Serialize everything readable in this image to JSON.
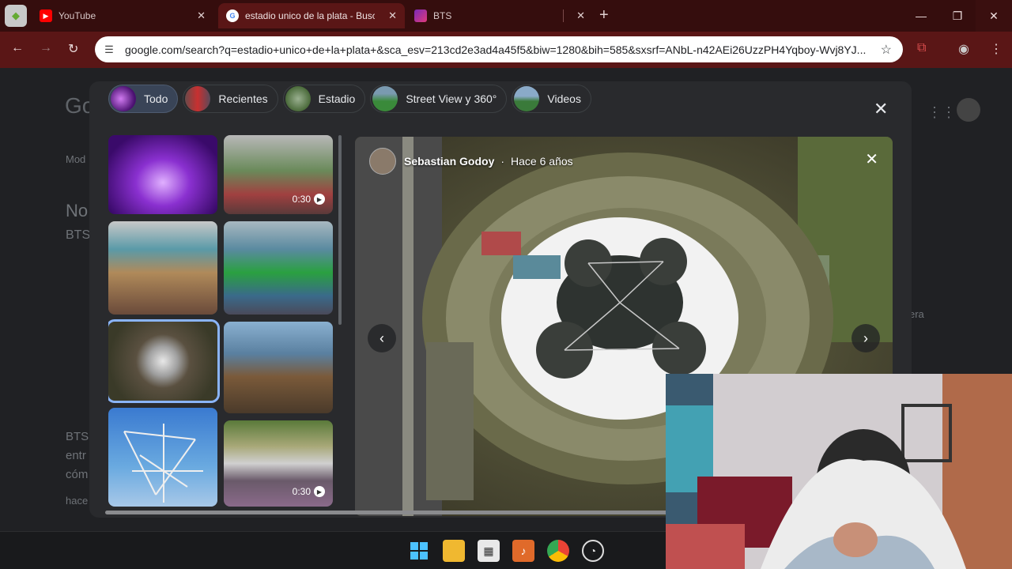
{
  "browser": {
    "tabs": [
      {
        "title": "YouTube",
        "active": false
      },
      {
        "title": "estadio unico de la plata - Busca",
        "active": true
      },
      {
        "title": "BTS",
        "active": false
      }
    ],
    "url": "google.com/search?q=estadio+unico+de+la+plata+&sca_esv=213cd2e3ad4a45f5&biw=1280&bih=585&sxsrf=ANbL-n42AEi26UzzPH4Yqboy-Wvj8YJ..."
  },
  "background_page": {
    "logo": "Go",
    "mode_label": "Mod",
    "no_text": "No",
    "bts_text": "BTS",
    "snippet_lines": [
      "BTS",
      "entr",
      "cóm"
    ],
    "hace": "hace",
    "side_label": "era"
  },
  "viewer": {
    "chips": [
      {
        "label": "Todo",
        "active": true
      },
      {
        "label": "Recientes",
        "active": false
      },
      {
        "label": "Estadio",
        "active": false
      },
      {
        "label": "Street View y 360°",
        "active": false
      },
      {
        "label": "Videos",
        "active": false
      }
    ],
    "thumbnails": [
      {
        "duration": ""
      },
      {
        "duration": "0:30"
      },
      {
        "duration": ""
      },
      {
        "duration": ""
      },
      {
        "duration": "",
        "selected": true
      },
      {
        "duration": ""
      },
      {
        "duration": ""
      },
      {
        "duration": "0:30"
      }
    ],
    "image": {
      "author": "Sebastian Godoy",
      "time": "Hace 6 años"
    }
  },
  "colors": {
    "accent": "#8ab4f8",
    "tab_bar": "#350d0d",
    "toolbar": "#5a1616"
  }
}
